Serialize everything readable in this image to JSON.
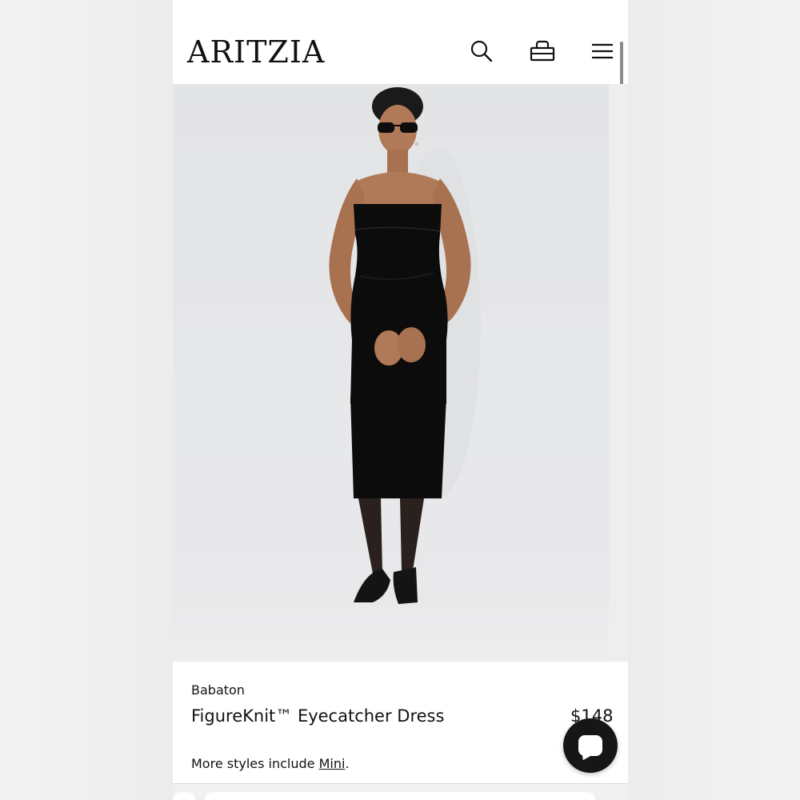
{
  "header": {
    "logo": "ARITZIA",
    "icons": [
      "search-icon",
      "shopping-bag-icon",
      "hamburger-menu-icon"
    ]
  },
  "product": {
    "brand": "Babaton",
    "name": "FigureKnit™ Eyecatcher Dress",
    "price": "$148",
    "more_prefix": "More styles include ",
    "more_link": "Mini",
    "more_suffix": "."
  },
  "chat": {
    "icon": "chat-icon"
  },
  "colors": {
    "accent": "#111111",
    "background": "#ffffff"
  }
}
